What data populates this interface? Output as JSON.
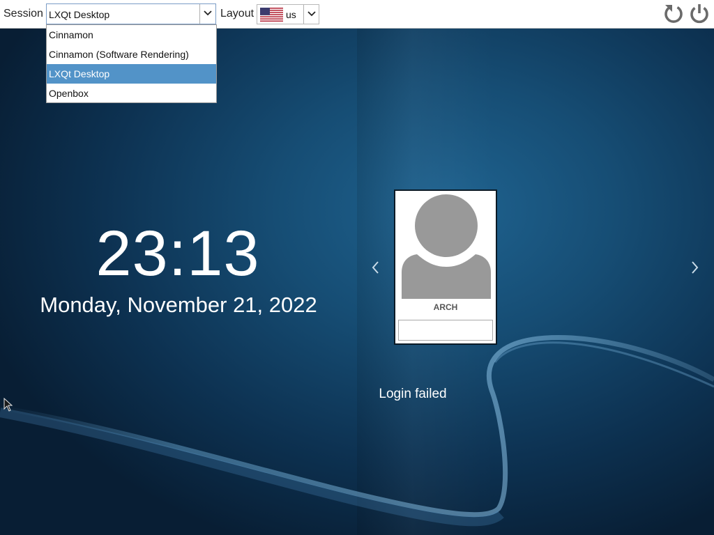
{
  "topbar": {
    "session_label": "Session",
    "session_value": "LXQt Desktop",
    "layout_label": "Layout",
    "layout_value": "us",
    "layout_flag_icon": "us-flag-icon",
    "reboot_icon": "restart-icon",
    "power_icon": "power-icon"
  },
  "session_dropdown": {
    "items": [
      {
        "label": "Cinnamon",
        "selected": false
      },
      {
        "label": "Cinnamon (Software Rendering)",
        "selected": false
      },
      {
        "label": "LXQt Desktop",
        "selected": true
      },
      {
        "label": "Openbox",
        "selected": false
      }
    ]
  },
  "clock": {
    "time": "23:13",
    "date": "Monday, November 21, 2022"
  },
  "user": {
    "name": "ARCH",
    "password_value": "",
    "avatar_icon": "user-avatar-icon"
  },
  "status": {
    "message": "Login failed"
  },
  "colors": {
    "accent": "#5293c8",
    "background_dark": "#0d3252",
    "background_light": "#1f6390"
  }
}
